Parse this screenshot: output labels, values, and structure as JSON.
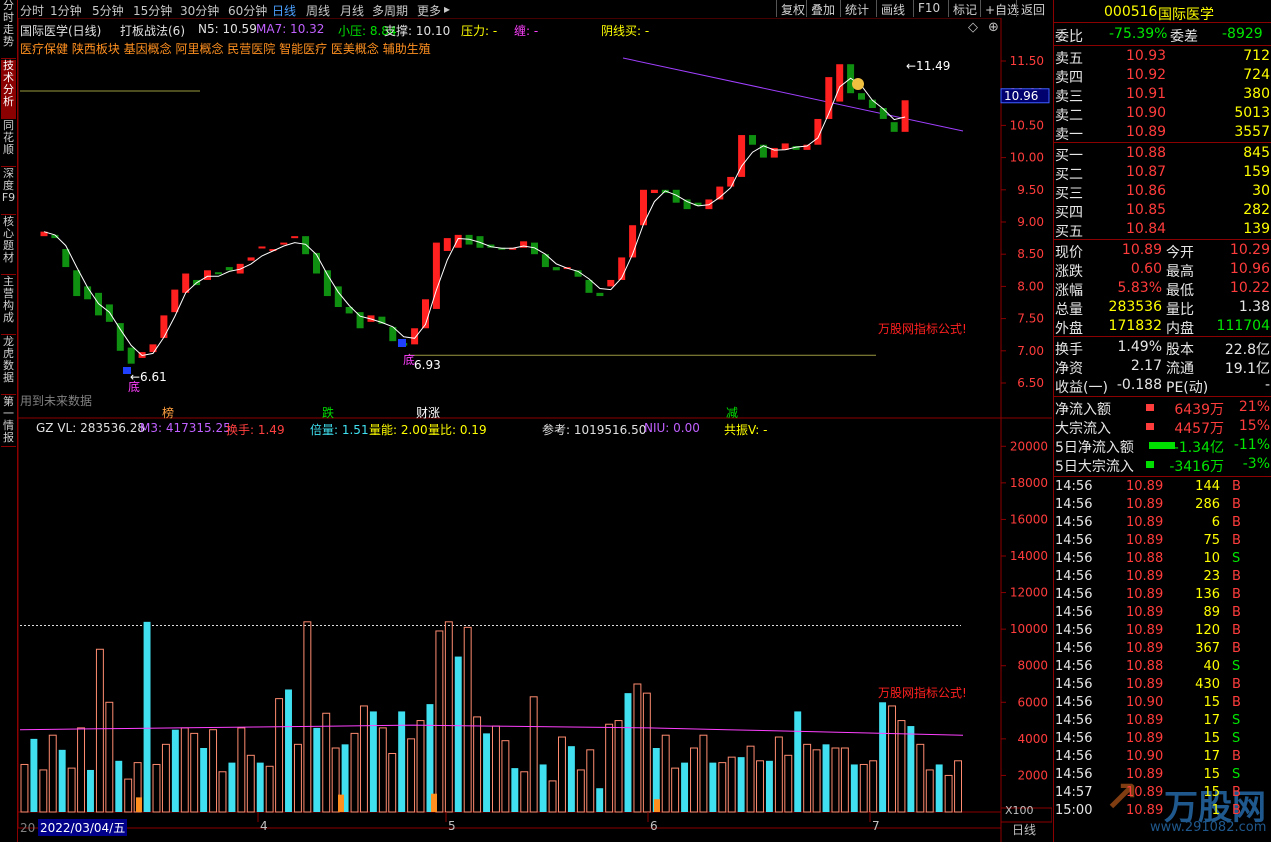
{
  "tabs_left": [
    "分时走势",
    "技术分析",
    "同花顺",
    "深度F9",
    "核心题材",
    "主营构成",
    "龙虎数据",
    "第一情报"
  ],
  "periods": [
    "分时",
    "1分钟",
    "5分钟",
    "15分钟",
    "30分钟",
    "60分钟",
    "日线",
    "周线",
    "月线",
    "多周期",
    "更多"
  ],
  "active_period": "日线",
  "toolbar": {
    "fq": "复权",
    "overlay": "叠加",
    "stats": "统计",
    "draw": "画线",
    "f10": "F10",
    "mark": "标记",
    "add_fav": "+自选",
    "back": "返回"
  },
  "header": {
    "title": "国际医学(日线)",
    "strategy": "打板战法(6)",
    "n5": "N5: 10.59",
    "ma7": "MA7: 10.32",
    "xiaoya": "小压: 8.84",
    "zhicheng": "支撑: 10.10",
    "yali": "压力: -",
    "chan": "缠: -",
    "yinxian": "阴线买: -"
  },
  "concepts": "医疗保健 陕西板块 基因概念 阿里概念 民营医院 智能医疗 医美概念 辅助生殖",
  "price_chart": {
    "y_ticks": [
      "11.50",
      "11.00",
      "10.50",
      "10.00",
      "9.50",
      "9.00",
      "8.50",
      "8.00",
      "7.50",
      "7.00",
      "6.50"
    ],
    "current_price": "10.96",
    "high_label": "11.49",
    "low_label_1": "6.61",
    "low_label_2": "6.93",
    "di_1": "底",
    "di_2": "底",
    "watermark": "万股网指标公式!",
    "future_note": "用到未来数据"
  },
  "markers": {
    "bang": "榜",
    "die": "跌",
    "caizhang": "财涨",
    "jian": "减"
  },
  "volume_header": {
    "gz": "GZ VL: 283536.28",
    "m3": "M3: 417315.25",
    "huanshou": "换手: 1.49",
    "beiliang": "倍量: 1.51",
    "liangneng": "量能: 2.00",
    "liangbi": "量比: 0.19",
    "cankao": "参考: 1019516.50",
    "niu": "NIU: 0.00",
    "gongzhen": "共振V: -"
  },
  "volume_chart": {
    "y_ticks": [
      "20000",
      "18000",
      "16000",
      "14000",
      "12000",
      "10000",
      "8000",
      "6000",
      "4000",
      "2000"
    ],
    "unit": "X100",
    "watermark": "万股网指标公式!"
  },
  "date_axis": {
    "first": "20",
    "cursor": "2022/03/04/五",
    "labels": [
      "4",
      "5",
      "6",
      "7"
    ],
    "period_btn": "日线"
  },
  "colors": {
    "up": "#ff2020",
    "down": "#109010",
    "vol_up": "#ff8c70",
    "vol_down": "#40e0f0",
    "ma": "#ffffff",
    "trend": "#a040ff"
  },
  "quote": {
    "code": "000516",
    "name": "国际医学",
    "weibi_label": "委比",
    "weibi": "-75.39%",
    "weicha_label": "委差",
    "weicha": "-8929",
    "asks": [
      {
        "label": "卖五",
        "price": "10.93",
        "vol": "712"
      },
      {
        "label": "卖四",
        "price": "10.92",
        "vol": "724"
      },
      {
        "label": "卖三",
        "price": "10.91",
        "vol": "380"
      },
      {
        "label": "卖二",
        "price": "10.90",
        "vol": "5013"
      },
      {
        "label": "卖一",
        "price": "10.89",
        "vol": "3557"
      }
    ],
    "bids": [
      {
        "label": "买一",
        "price": "10.88",
        "vol": "845"
      },
      {
        "label": "买二",
        "price": "10.87",
        "vol": "159"
      },
      {
        "label": "买三",
        "price": "10.86",
        "vol": "30"
      },
      {
        "label": "买四",
        "price": "10.85",
        "vol": "282"
      },
      {
        "label": "买五",
        "price": "10.84",
        "vol": "139"
      }
    ],
    "stats": [
      {
        "l1": "现价",
        "v1": "10.89",
        "l2": "今开",
        "v2": "10.29"
      },
      {
        "l1": "涨跌",
        "v1": "0.60",
        "l2": "最高",
        "v2": "10.96"
      },
      {
        "l1": "涨幅",
        "v1": "5.83%",
        "l2": "最低",
        "v2": "10.22"
      },
      {
        "l1": "总量",
        "v1": "283536",
        "l2": "量比",
        "v2": "1.38"
      },
      {
        "l1": "外盘",
        "v1": "171832",
        "l2": "内盘",
        "v2": "111704"
      }
    ],
    "stats2": [
      {
        "l1": "换手",
        "v1": "1.49%",
        "l2": "股本",
        "v2": "22.8亿"
      },
      {
        "l1": "净资",
        "v1": "2.17",
        "l2": "流通",
        "v2": "19.1亿"
      },
      {
        "l1": "收益(一)",
        "v1": "-0.188",
        "l2": "PE(动)",
        "v2": "-"
      }
    ],
    "flows": [
      {
        "label": "净流入额",
        "value": "6439万",
        "pct": "21%"
      },
      {
        "label": "大宗流入",
        "value": "4457万",
        "pct": "15%"
      },
      {
        "label": "5日净流入额",
        "value": "-1.34亿",
        "pct": "-11%"
      },
      {
        "label": "5日大宗流入",
        "value": "-3416万",
        "pct": "-3%"
      }
    ],
    "ticks": [
      {
        "t": "14:56",
        "p": "10.89",
        "v": "144",
        "d": "B"
      },
      {
        "t": "14:56",
        "p": "10.89",
        "v": "286",
        "d": "B"
      },
      {
        "t": "14:56",
        "p": "10.89",
        "v": "6",
        "d": "B"
      },
      {
        "t": "14:56",
        "p": "10.89",
        "v": "75",
        "d": "B"
      },
      {
        "t": "14:56",
        "p": "10.88",
        "v": "10",
        "d": "S"
      },
      {
        "t": "14:56",
        "p": "10.89",
        "v": "23",
        "d": "B"
      },
      {
        "t": "14:56",
        "p": "10.89",
        "v": "136",
        "d": "B"
      },
      {
        "t": "14:56",
        "p": "10.89",
        "v": "89",
        "d": "B"
      },
      {
        "t": "14:56",
        "p": "10.89",
        "v": "120",
        "d": "B"
      },
      {
        "t": "14:56",
        "p": "10.89",
        "v": "367",
        "d": "B"
      },
      {
        "t": "14:56",
        "p": "10.88",
        "v": "40",
        "d": "S"
      },
      {
        "t": "14:56",
        "p": "10.89",
        "v": "430",
        "d": "B"
      },
      {
        "t": "14:56",
        "p": "10.90",
        "v": "15",
        "d": "B"
      },
      {
        "t": "14:56",
        "p": "10.89",
        "v": "17",
        "d": "S"
      },
      {
        "t": "14:56",
        "p": "10.89",
        "v": "15",
        "d": "S"
      },
      {
        "t": "14:56",
        "p": "10.90",
        "v": "17",
        "d": "B"
      },
      {
        "t": "14:56",
        "p": "10.89",
        "v": "15",
        "d": "S"
      },
      {
        "t": "14:57",
        "p": "10.89",
        "v": "15",
        "d": "B"
      },
      {
        "t": "15:00",
        "p": "10.89",
        "v": "1",
        "d": "B"
      }
    ],
    "brand_watermark": "万股网",
    "brand_url": "www.291082.com"
  },
  "chart_data": [
    {
      "type": "candlestick",
      "title": "国际医学(日线)",
      "open": [
        8.78,
        8.8,
        8.58,
        8.25,
        8.0,
        7.9,
        7.72,
        7.43,
        7.05,
        6.89,
        6.98,
        7.2,
        7.6,
        7.9,
        8.1,
        8.1,
        8.22,
        8.3,
        8.2,
        8.4,
        8.62,
        8.58,
        8.65,
        8.78,
        8.78,
        8.52,
        8.25,
        8.0,
        7.68,
        7.6,
        7.45,
        7.53,
        7.37,
        7.12,
        7.1,
        7.35,
        7.65,
        8.55,
        8.6,
        8.8,
        8.78,
        8.65,
        8.6,
        8.58,
        8.6,
        8.68,
        8.5,
        8.3,
        8.3,
        8.25,
        8.1,
        7.9,
        8.0,
        8.1,
        8.45,
        8.95,
        9.45,
        9.5,
        9.5,
        9.35,
        9.3,
        9.2,
        9.35,
        9.55,
        9.7,
        10.35,
        10.2,
        10.0,
        10.12,
        10.18,
        10.12,
        10.2,
        10.6,
        10.87,
        11.45,
        11.0,
        10.9,
        10.77,
        10.55,
        10.4
      ],
      "close": [
        8.85,
        8.75,
        8.3,
        7.85,
        7.8,
        7.55,
        7.45,
        7.0,
        6.8,
        6.98,
        7.1,
        7.55,
        7.95,
        8.2,
        8.02,
        8.25,
        8.2,
        8.25,
        8.35,
        8.45,
        8.62,
        8.58,
        8.68,
        8.78,
        8.5,
        8.2,
        7.85,
        7.68,
        7.58,
        7.35,
        7.55,
        7.42,
        7.15,
        7.08,
        7.35,
        7.8,
        8.68,
        8.75,
        8.8,
        8.65,
        8.6,
        8.6,
        8.58,
        8.6,
        8.7,
        8.5,
        8.3,
        8.25,
        8.3,
        8.15,
        7.9,
        7.85,
        8.1,
        8.45,
        8.95,
        9.5,
        9.5,
        9.45,
        9.3,
        9.2,
        9.25,
        9.35,
        9.55,
        9.7,
        10.35,
        10.2,
        10.0,
        10.15,
        10.22,
        10.12,
        10.2,
        10.6,
        11.25,
        11.45,
        11.0,
        10.9,
        10.77,
        10.6,
        10.4,
        10.89
      ]
    },
    {
      "type": "bar",
      "title": "GZ VL",
      "values": [
        2600,
        4000,
        2300,
        4200,
        3400,
        2400,
        4600,
        2300,
        8900,
        6000,
        2800,
        1800,
        2700,
        10400,
        2600,
        3700,
        4500,
        4600,
        4300,
        3500,
        4500,
        2200,
        2700,
        4600,
        3100,
        2700,
        2500,
        6200,
        6700,
        3700,
        10400,
        4600,
        5400,
        3500,
        3700,
        4300,
        5800,
        5500,
        4600,
        3200,
        5500,
        4000,
        5000,
        5900,
        9900,
        10400,
        8500,
        10100,
        5200,
        4300,
        4700,
        3900,
        2400,
        2200,
        6300,
        2600,
        1700,
        4100,
        3600,
        2300,
        3400,
        1300,
        4800,
        5000,
        6500,
        7000,
        6500,
        3500,
        4200,
        2400,
        2700,
        3500,
        4200,
        2700,
        2700,
        3000,
        3000,
        3600,
        2800,
        2800,
        4100,
        3100,
        5500,
        3700,
        3400,
        3700,
        3500,
        3500,
        2600,
        2600,
        2800,
        6000,
        5800,
        5000,
        4700,
        3700,
        2300,
        2600,
        2000,
        2800
      ],
      "ylim": [
        0,
        21000
      ],
      "ma_values": [
        4500,
        4550,
        4600,
        4650,
        4700,
        4750,
        4700,
        4650,
        4600,
        4500,
        4400,
        4300,
        4200
      ]
    }
  ]
}
